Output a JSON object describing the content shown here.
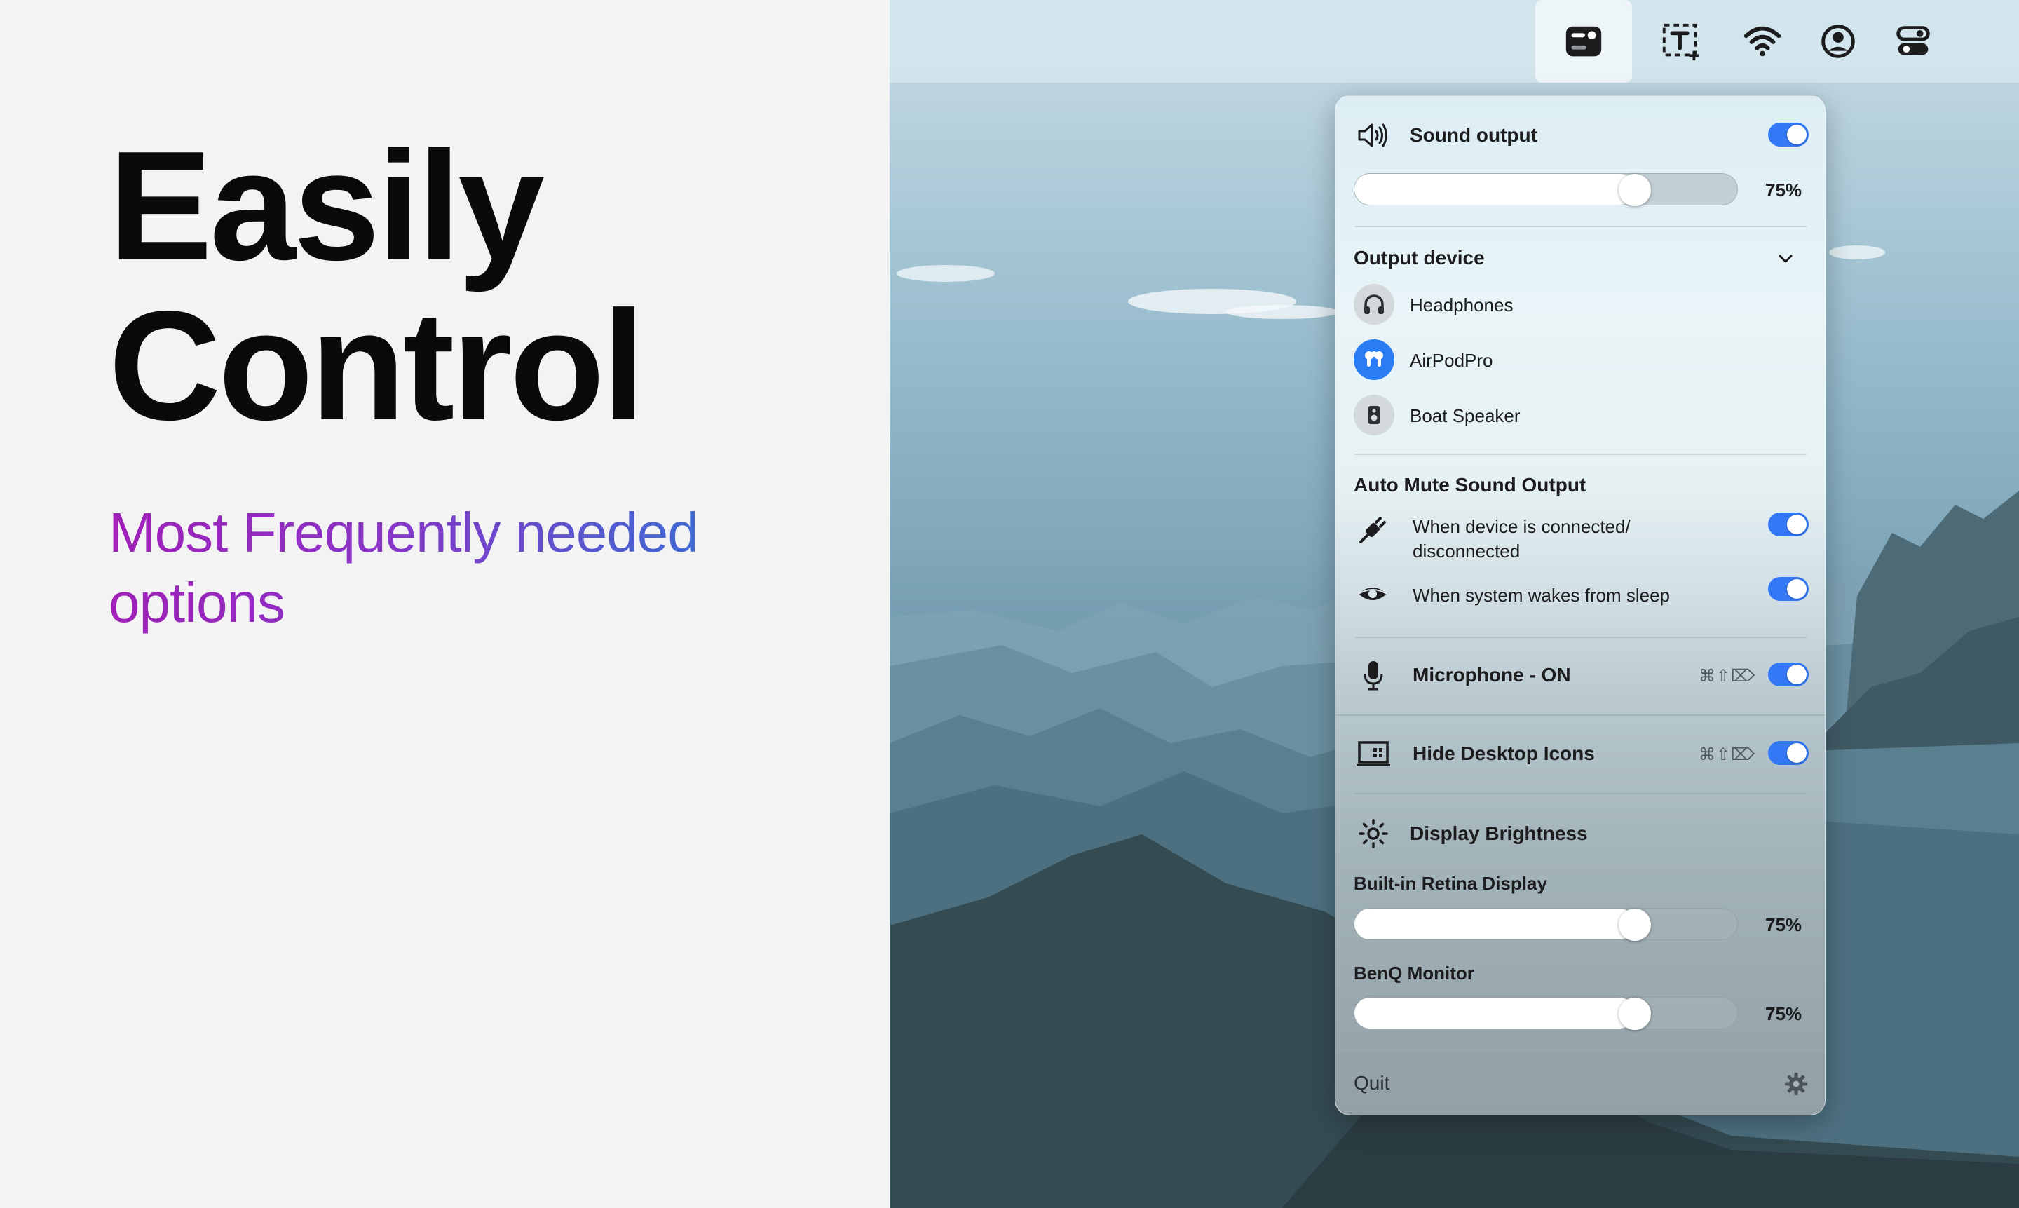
{
  "hero": {
    "line1": "Easily",
    "line2": "Control",
    "subtitle": "Most Frequently needed options"
  },
  "menubar": {
    "icons": [
      "toggle-app-icon",
      "text-capture-icon",
      "wifi-icon",
      "user-account-icon",
      "control-center-icon"
    ]
  },
  "panel": {
    "sound": {
      "title": "Sound output",
      "volume_percent": 75,
      "volume_label": "75%",
      "enabled": true
    },
    "output_device": {
      "title": "Output device",
      "devices": [
        {
          "name": "Headphones",
          "icon": "headphones-icon",
          "selected": false
        },
        {
          "name": "AirPodPro",
          "icon": "airpods-icon",
          "selected": true
        },
        {
          "name": "Boat Speaker",
          "icon": "speaker-icon",
          "selected": false
        }
      ]
    },
    "auto_mute": {
      "title": "Auto Mute Sound Output",
      "options": [
        {
          "label_line1": "When device is connected/",
          "label_line2": "disconnected",
          "enabled": true
        },
        {
          "label": "When system wakes from sleep",
          "enabled": true
        }
      ]
    },
    "microphone": {
      "title": "Microphone - ON",
      "shortcut": "⌘⇧⌦",
      "enabled": true
    },
    "desktop_icons": {
      "title": "Hide Desktop Icons",
      "shortcut": "⌘⇧⌦",
      "enabled": true
    },
    "brightness": {
      "title": "Display Brightness",
      "displays": [
        {
          "name": "Built-in Retina Display",
          "percent": 75,
          "label": "75%"
        },
        {
          "name": "BenQ Monitor",
          "percent": 75,
          "label": "75%"
        }
      ]
    },
    "footer": {
      "quit_label": "Quit"
    }
  },
  "colors": {
    "accent": "#3478f6",
    "gradient_start": "#a020b8",
    "gradient_end": "#2b78d6"
  }
}
